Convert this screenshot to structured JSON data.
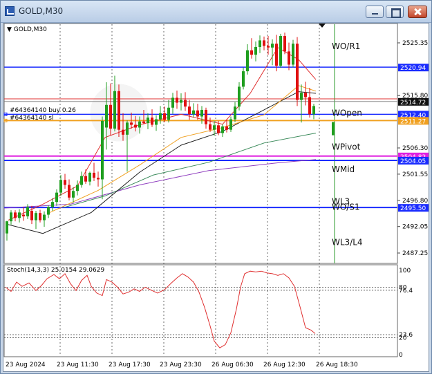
{
  "window": {
    "title": "GOLD,M30"
  },
  "chart": {
    "symbol_label": "GOLD,M30",
    "price_ticks": [
      "2525.35",
      "2515.80",
      "2506.30",
      "2501.55",
      "2496.80",
      "2492.05",
      "2487.25"
    ],
    "price_tags": [
      {
        "name": "wo-r1-tag",
        "text": "2520.94",
        "color": "#1a2cff",
        "price": 2520.94
      },
      {
        "name": "current-price-tag",
        "text": "2514.72",
        "color": "#111111",
        "price": 2514.72
      },
      {
        "name": "buy-level-tag",
        "text": "2512.40",
        "color": "#1a2cff",
        "price": 2512.4
      },
      {
        "name": "stoploss-tag",
        "text": "2511.27",
        "color": "#f0a020",
        "price": 2511.27
      },
      {
        "name": "pivot-magenta-tag",
        "text": "2504.82",
        "color": "#e020e0",
        "price": 2504.82
      },
      {
        "name": "pivot-blue-tag",
        "text": "2504.05",
        "color": "#1a2cff",
        "price": 2504.05
      },
      {
        "name": "wl3-tag",
        "text": "2495.50",
        "color": "#1a2cff",
        "price": 2495.5
      }
    ],
    "level_labels": [
      "WO/R1",
      "WOpen",
      "WPivot",
      "WMid",
      "WL3",
      "WO/S1",
      "WL3/L4"
    ],
    "order_labels": {
      "buy": "#64364140 buy 0.26",
      "sl": "#64364140 sl"
    },
    "stoch_label": "Stoch(14,3,3) 25.0154 29.0629",
    "stoch_ticks": [
      "100",
      "80",
      "76.4",
      "23.6",
      "20",
      "0"
    ],
    "time_labels": [
      "23 Aug 2024",
      "23 Aug 11:30",
      "23 Aug 17:30",
      "23 Aug 23:30",
      "26 Aug 06:30",
      "26 Aug 12:30",
      "26 Aug 18:30"
    ],
    "colors": {
      "bull": "#1f9e1f",
      "bear": "#e01010",
      "level_blue": "#1a2cff",
      "magenta": "#e020e0",
      "orange": "#f0a020",
      "ma_red": "#e03030",
      "ma_black": "#222222",
      "ma_green": "#3a8a5a",
      "ma_purple": "#9040c0"
    }
  }
}
